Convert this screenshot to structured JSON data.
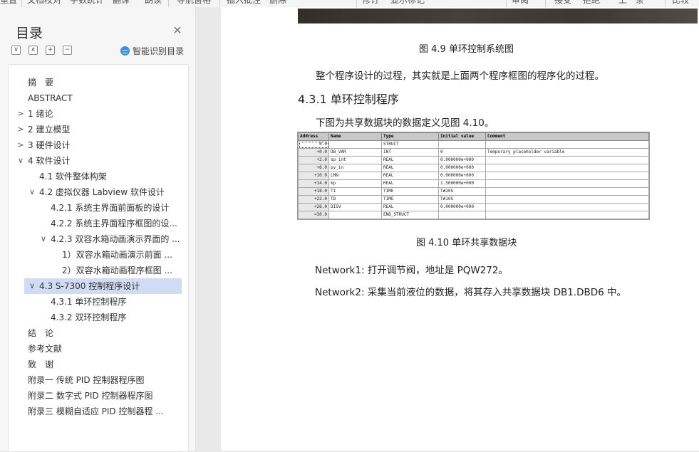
{
  "toolbar": {
    "items": [
      "重置",
      "文档校对",
      "字数统计",
      "翻译",
      "朗读",
      "导航窗格",
      "插入批注",
      "删除",
      "修订",
      "显示标记",
      "审阅",
      "接受",
      "拒绝",
      "上一条",
      "比较"
    ]
  },
  "nav": {
    "title": "目录",
    "ai_label": "智能识别目录",
    "tools": [
      "∨",
      "∧",
      "+",
      "−"
    ],
    "items": [
      {
        "label": "摘　要",
        "level": 1,
        "chevron": ""
      },
      {
        "label": "ABSTRACT",
        "level": 1,
        "chevron": ""
      },
      {
        "label": "1 绪论",
        "level": 1,
        "chevron": ">"
      },
      {
        "label": "2 建立模型",
        "level": 1,
        "chevron": ">"
      },
      {
        "label": "3 硬件设计",
        "level": 1,
        "chevron": ">"
      },
      {
        "label": "4 软件设计",
        "level": 1,
        "chevron": "∨"
      },
      {
        "label": "4.1 软件整体构架",
        "level": 2,
        "chevron": ""
      },
      {
        "label": "4.2 虚拟仪器 Labview 软件设计",
        "level": 2,
        "chevron": "∨"
      },
      {
        "label": "4.2.1  系统主界面前面板的设计",
        "level": 3,
        "chevron": ""
      },
      {
        "label": "4.2.2  系统主界面程序框图的设...",
        "level": 3,
        "chevron": ""
      },
      {
        "label": "4.2.3  双容水箱动画演示界面的 ...",
        "level": 3,
        "chevron": "∨"
      },
      {
        "label": "1）双容水箱动画演示前面 ...",
        "level": 4,
        "chevron": ""
      },
      {
        "label": "2）双容水箱动画程序框图 ...",
        "level": 4,
        "chevron": ""
      },
      {
        "label": "4.3 S-7300 控制程序设计",
        "level": 2,
        "chevron": "∨",
        "selected": true
      },
      {
        "label": "4.3.1 单环控制程序",
        "level": 3,
        "chevron": ""
      },
      {
        "label": "4.3.2 双环控制程序",
        "level": 3,
        "chevron": ""
      },
      {
        "label": "结　论",
        "level": 1,
        "chevron": ""
      },
      {
        "label": "参考文献",
        "level": 1,
        "chevron": ""
      },
      {
        "label": "致　谢",
        "level": 1,
        "chevron": ""
      },
      {
        "label": "附录一  传统 PID 控制器程序图",
        "level": 1,
        "chevron": ""
      },
      {
        "label": "附录二  数字式 PID 控制器程序图",
        "level": 1,
        "chevron": ""
      },
      {
        "label": "附录三  模糊自适应 PID 控制器程 ...",
        "level": 1,
        "chevron": ""
      }
    ]
  },
  "doc": {
    "fig49_caption": "图  4.9    单环控制系统图",
    "para1": "整个程序设计的过程，其实就是上面两个程序框图的程序化的过程。",
    "heading": "4.3.1 单环控制程序",
    "para2": "下图为共享数据块的数据定义见图  4.10。",
    "fig410_caption": "图   4.10    单环共享数据块",
    "network1": "Network1:  打开调节阀，地址是      PQW272。",
    "network2": "Network2:  采集当前液位的数据，将其存入共享数据块 DB1.DBD6 中。"
  },
  "table": {
    "headers": [
      "Address",
      "Name",
      "Type",
      "Initial value",
      "Comment"
    ],
    "rows": [
      [
        "0.0",
        "",
        "STRUCT",
        "",
        ""
      ],
      [
        "+0.0",
        "DB_VAR",
        "INT",
        "0",
        "Temporary placeholder variable"
      ],
      [
        "+2.0",
        "sp_int",
        "REAL",
        "0.000000e+000",
        ""
      ],
      [
        "+6.0",
        "pv_in",
        "REAL",
        "0.000000e+000",
        ""
      ],
      [
        "+10.0",
        "LMN",
        "REAL",
        "0.000000e+000",
        ""
      ],
      [
        "+14.0",
        "kp",
        "REAL",
        "1.500000e+000",
        ""
      ],
      [
        "+18.0",
        "TI",
        "TIME",
        "T#20S",
        ""
      ],
      [
        "+22.0",
        "TD",
        "TIME",
        "T#10S",
        ""
      ],
      [
        "+26.0",
        "DISV",
        "REAL",
        "0.000000e+000",
        ""
      ],
      [
        "=30.0",
        "",
        "END_STRUCT",
        "",
        ""
      ]
    ]
  }
}
